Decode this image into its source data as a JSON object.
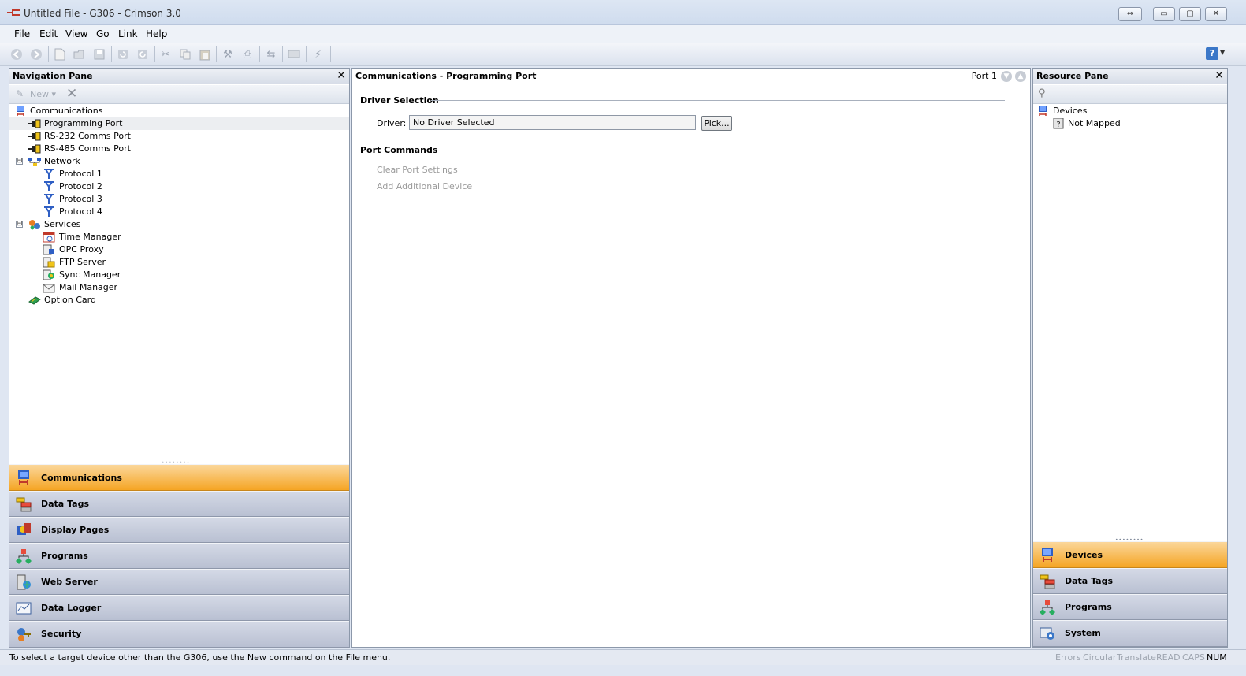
{
  "window": {
    "title": "Untitled File - G306 - Crimson 3.0",
    "buttons": [
      "⇔",
      "▭",
      "▢",
      "✕"
    ]
  },
  "menu": [
    "File",
    "Edit",
    "View",
    "Go",
    "Link",
    "Help"
  ],
  "toolbar": {
    "icons": [
      "back-icon",
      "forward-icon",
      "new-icon",
      "open-icon",
      "save-icon",
      "undo-icon",
      "redo-icon",
      "cut-icon",
      "copy-icon",
      "paste-icon",
      "find-icon",
      "replace-icon",
      "link-icon",
      "display-icon",
      "send-icon"
    ],
    "help": "?"
  },
  "nav_pane": {
    "title": "Navigation Pane",
    "new_label": "New",
    "tree": [
      {
        "label": "Communications",
        "level": 0,
        "icon": "communications-icon"
      },
      {
        "label": "Programming Port",
        "level": 1,
        "icon": "port-icon",
        "selected": true
      },
      {
        "label": "RS-232 Comms Port",
        "level": 1,
        "icon": "port-icon"
      },
      {
        "label": "RS-485 Comms Port",
        "level": 1,
        "icon": "port-icon"
      },
      {
        "label": "Network",
        "level": 1,
        "icon": "network-icon",
        "expander": "⊟"
      },
      {
        "label": "Protocol 1",
        "level": 2,
        "icon": "protocol-icon"
      },
      {
        "label": "Protocol 2",
        "level": 2,
        "icon": "protocol-icon"
      },
      {
        "label": "Protocol 3",
        "level": 2,
        "icon": "protocol-icon"
      },
      {
        "label": "Protocol 4",
        "level": 2,
        "icon": "protocol-icon"
      },
      {
        "label": "Services",
        "level": 1,
        "icon": "services-icon",
        "expander": "⊟"
      },
      {
        "label": "Time Manager",
        "level": 2,
        "icon": "time-manager-icon"
      },
      {
        "label": "OPC Proxy",
        "level": 2,
        "icon": "opc-proxy-icon"
      },
      {
        "label": "FTP Server",
        "level": 2,
        "icon": "ftp-server-icon"
      },
      {
        "label": "Sync Manager",
        "level": 2,
        "icon": "sync-manager-icon"
      },
      {
        "label": "Mail Manager",
        "level": 2,
        "icon": "mail-manager-icon"
      },
      {
        "label": "Option Card",
        "level": 1,
        "icon": "option-card-icon"
      }
    ],
    "categories": [
      {
        "label": "Communications",
        "active": true,
        "icon": "communications-icon"
      },
      {
        "label": "Data Tags",
        "icon": "data-tags-icon"
      },
      {
        "label": "Display Pages",
        "icon": "display-pages-icon"
      },
      {
        "label": "Programs",
        "icon": "programs-icon"
      },
      {
        "label": "Web Server",
        "icon": "web-server-icon"
      },
      {
        "label": "Data Logger",
        "icon": "data-logger-icon"
      },
      {
        "label": "Security",
        "icon": "security-icon"
      }
    ]
  },
  "center": {
    "title": "Communications - Programming Port",
    "port_label": "Port 1",
    "driver_section": "Driver Selection",
    "driver_label": "Driver:",
    "driver_value": "No Driver Selected",
    "pick_button": "Pick...",
    "commands_section": "Port Commands",
    "commands": [
      "Clear Port Settings",
      "Add Additional Device"
    ]
  },
  "resource_pane": {
    "title": "Resource Pane",
    "tree": [
      {
        "label": "Devices",
        "level": 0,
        "icon": "devices-icon"
      },
      {
        "label": "Not Mapped",
        "level": 1,
        "icon": "question-icon"
      }
    ],
    "categories": [
      {
        "label": "Devices",
        "active": true,
        "icon": "devices-icon"
      },
      {
        "label": "Data Tags",
        "icon": "data-tags-icon"
      },
      {
        "label": "Programs",
        "icon": "programs-icon"
      },
      {
        "label": "System",
        "icon": "system-icon"
      }
    ]
  },
  "status": {
    "text": "To select a target device other than the G306, use the New command on the File menu.",
    "indicators": [
      {
        "label": "Errors",
        "on": false
      },
      {
        "label": "Circular",
        "on": false
      },
      {
        "label": "Translate",
        "on": false
      },
      {
        "label": "READ",
        "on": false
      },
      {
        "label": "CAPS",
        "on": false
      },
      {
        "label": "NUM",
        "on": true
      }
    ]
  },
  "colors": {
    "active_category": "#f5a524",
    "pane_border": "#8c98aa",
    "disabled_text": "#9a9a9a"
  }
}
